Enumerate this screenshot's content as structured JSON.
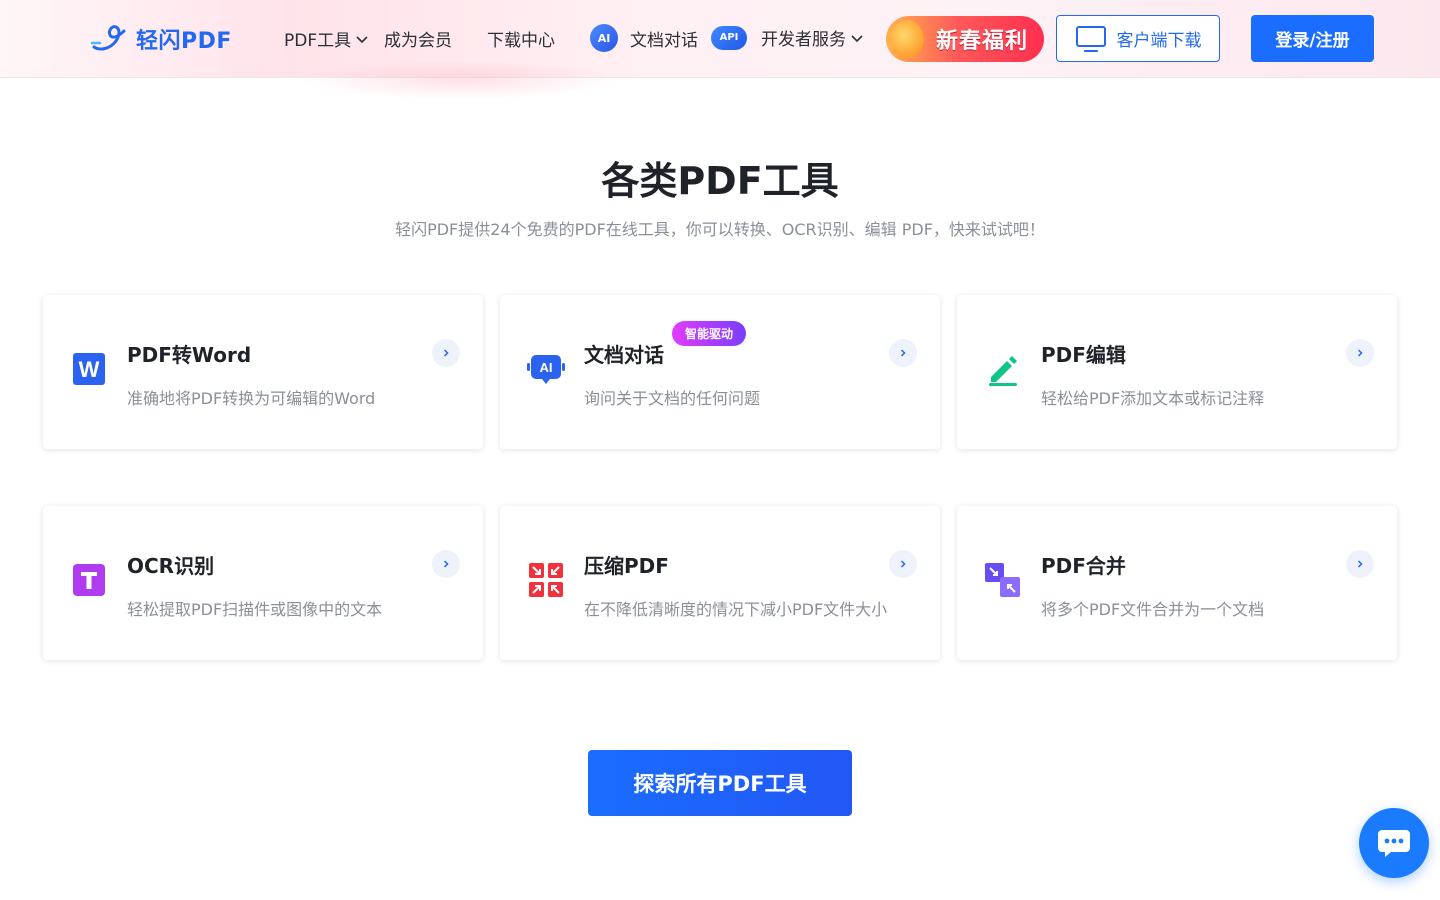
{
  "header": {
    "logo_text": "轻闪PDF",
    "nav": [
      {
        "label": "PDF工具",
        "has_dropdown": true
      },
      {
        "label": "成为会员",
        "has_dropdown": false
      },
      {
        "label": "下载中心",
        "has_dropdown": false
      },
      {
        "label": "文档对话",
        "badge": "AI",
        "has_dropdown": false
      },
      {
        "label": "开发者服务",
        "badge": "API",
        "has_dropdown": true
      }
    ],
    "promo_text": "新春福利",
    "client_download_label": "客户端下载",
    "login_label": "登录/注册"
  },
  "section": {
    "title": "各类PDF工具",
    "subtitle": "轻闪PDF提供24个免费的PDF在线工具，你可以转换、OCR识别、编辑 PDF，快来试试吧！"
  },
  "tools": [
    {
      "title": "PDF转Word",
      "desc": "准确地将PDF转换为可编辑的Word",
      "icon": "word-icon"
    },
    {
      "title": "文档对话",
      "desc": "询问关于文档的任何问题",
      "icon": "ai-chat-icon",
      "tag": "智能驱动"
    },
    {
      "title": "PDF编辑",
      "desc": "轻松给PDF添加文本或标记注释",
      "icon": "edit-icon"
    },
    {
      "title": "OCR识别",
      "desc": "轻松提取PDF扫描件或图像中的文本",
      "icon": "ocr-icon"
    },
    {
      "title": "压缩PDF",
      "desc": "在不降低清晰度的情况下减小PDF文件大小",
      "icon": "compress-icon"
    },
    {
      "title": "PDF合并",
      "desc": "将多个PDF文件合并为一个文档",
      "icon": "merge-icon"
    }
  ],
  "explore_label": "探索所有PDF工具",
  "colors": {
    "brand_blue": "#1a6dff",
    "text_primary": "#1f2329",
    "text_secondary": "#8a8f99"
  }
}
